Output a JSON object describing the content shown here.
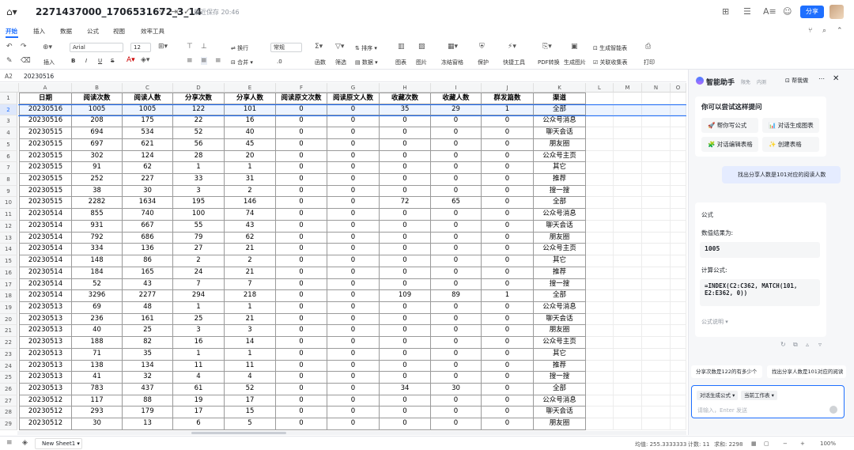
{
  "header": {
    "doc_title": "2271437000_1706531672_3_14",
    "save_status": "最近保存 20:46",
    "share_label": "分享"
  },
  "tabs": [
    "开始",
    "插入",
    "数据",
    "公式",
    "视图",
    "效率工具"
  ],
  "toolbar": {
    "insert": "插入",
    "font": "Arial",
    "font_size": "12",
    "wrap": "换行",
    "merge": "合并",
    "format": "常规",
    "decimal": ".0",
    "function": "函数",
    "filter": "筛选",
    "sort": "排序",
    "data": "数据",
    "chart": "图表",
    "image": "图片",
    "freeze": "冻结窗格",
    "protect": "保护",
    "quick_tools": "快捷工具",
    "pdf": "PDF转换",
    "gen_image": "生成图片",
    "gen_smart_table": "生成智能表",
    "link_collect": "关联收集表",
    "print": "打印"
  },
  "formula_bar": {
    "cell_ref": "A2",
    "value": "20230516"
  },
  "columns": [
    "A",
    "B",
    "C",
    "D",
    "E",
    "F",
    "G",
    "H",
    "I",
    "J",
    "K",
    "L",
    "M",
    "N",
    "O"
  ],
  "sheet": {
    "headers": [
      "日期",
      "阅读次数",
      "阅读人数",
      "分享次数",
      "分享人数",
      "阅读原文次数",
      "阅读原文人数",
      "收藏次数",
      "收藏人数",
      "群发篇数",
      "渠道"
    ],
    "rows": [
      [
        "20230516",
        "1005",
        "1005",
        "122",
        "101",
        "0",
        "0",
        "35",
        "29",
        "1",
        "全部"
      ],
      [
        "20230516",
        "208",
        "175",
        "22",
        "16",
        "0",
        "0",
        "0",
        "0",
        "0",
        "公众号消息"
      ],
      [
        "20230515",
        "694",
        "534",
        "52",
        "40",
        "0",
        "0",
        "0",
        "0",
        "0",
        "聊天会话"
      ],
      [
        "20230515",
        "697",
        "621",
        "56",
        "45",
        "0",
        "0",
        "0",
        "0",
        "0",
        "朋友圈"
      ],
      [
        "20230515",
        "302",
        "124",
        "28",
        "20",
        "0",
        "0",
        "0",
        "0",
        "0",
        "公众号主页"
      ],
      [
        "20230515",
        "91",
        "62",
        "1",
        "1",
        "0",
        "0",
        "0",
        "0",
        "0",
        "其它"
      ],
      [
        "20230515",
        "252",
        "227",
        "33",
        "31",
        "0",
        "0",
        "0",
        "0",
        "0",
        "推荐"
      ],
      [
        "20230515",
        "38",
        "30",
        "3",
        "2",
        "0",
        "0",
        "0",
        "0",
        "0",
        "搜一搜"
      ],
      [
        "20230515",
        "2282",
        "1634",
        "195",
        "146",
        "0",
        "0",
        "72",
        "65",
        "0",
        "全部"
      ],
      [
        "20230514",
        "855",
        "740",
        "100",
        "74",
        "0",
        "0",
        "0",
        "0",
        "0",
        "公众号消息"
      ],
      [
        "20230514",
        "931",
        "667",
        "55",
        "43",
        "0",
        "0",
        "0",
        "0",
        "0",
        "聊天会话"
      ],
      [
        "20230514",
        "792",
        "686",
        "79",
        "62",
        "0",
        "0",
        "0",
        "0",
        "0",
        "朋友圈"
      ],
      [
        "20230514",
        "334",
        "136",
        "27",
        "21",
        "0",
        "0",
        "0",
        "0",
        "0",
        "公众号主页"
      ],
      [
        "20230514",
        "148",
        "86",
        "2",
        "2",
        "0",
        "0",
        "0",
        "0",
        "0",
        "其它"
      ],
      [
        "20230514",
        "184",
        "165",
        "24",
        "21",
        "0",
        "0",
        "0",
        "0",
        "0",
        "推荐"
      ],
      [
        "20230514",
        "52",
        "43",
        "7",
        "7",
        "0",
        "0",
        "0",
        "0",
        "0",
        "搜一搜"
      ],
      [
        "20230514",
        "3296",
        "2277",
        "294",
        "218",
        "0",
        "0",
        "109",
        "89",
        "1",
        "全部"
      ],
      [
        "20230513",
        "69",
        "48",
        "1",
        "1",
        "0",
        "0",
        "0",
        "0",
        "0",
        "公众号消息"
      ],
      [
        "20230513",
        "236",
        "161",
        "25",
        "21",
        "0",
        "0",
        "0",
        "0",
        "0",
        "聊天会话"
      ],
      [
        "20230513",
        "40",
        "25",
        "3",
        "3",
        "0",
        "0",
        "0",
        "0",
        "0",
        "朋友圈"
      ],
      [
        "20230513",
        "188",
        "82",
        "16",
        "14",
        "0",
        "0",
        "0",
        "0",
        "0",
        "公众号主页"
      ],
      [
        "20230513",
        "71",
        "35",
        "1",
        "1",
        "0",
        "0",
        "0",
        "0",
        "0",
        "其它"
      ],
      [
        "20230513",
        "138",
        "134",
        "11",
        "11",
        "0",
        "0",
        "0",
        "0",
        "0",
        "推荐"
      ],
      [
        "20230513",
        "41",
        "32",
        "4",
        "4",
        "0",
        "0",
        "0",
        "0",
        "0",
        "搜一搜"
      ],
      [
        "20230513",
        "783",
        "437",
        "61",
        "52",
        "0",
        "0",
        "34",
        "30",
        "0",
        "全部"
      ],
      [
        "20230512",
        "117",
        "88",
        "19",
        "17",
        "0",
        "0",
        "0",
        "0",
        "0",
        "公众号消息"
      ],
      [
        "20230512",
        "293",
        "179",
        "17",
        "15",
        "0",
        "0",
        "0",
        "0",
        "0",
        "聊天会话"
      ],
      [
        "20230512",
        "30",
        "13",
        "6",
        "5",
        "0",
        "0",
        "0",
        "0",
        "0",
        "朋友圈"
      ]
    ]
  },
  "row_numbers": [
    "1",
    "2",
    "3",
    "4",
    "5",
    "6",
    "7",
    "8",
    "9",
    "10",
    "11",
    "12",
    "13",
    "14",
    "15",
    "16",
    "17",
    "18",
    "19",
    "20",
    "21",
    "22",
    "23",
    "24",
    "25",
    "26",
    "27",
    "28",
    "29"
  ],
  "ai": {
    "title": "智能助手",
    "badge1": "限免",
    "badge2": "内测",
    "help": "帮我做",
    "prompt_title": "你可以尝试这样提问",
    "chips": [
      "帮你写公式",
      "对话生成图表",
      "对话编辑表格",
      "创建表格"
    ],
    "user_msg": "找出分享人数是101对应的阅读人数",
    "answer_label": "公式",
    "result_label": "数值结果为:",
    "result_value": "1005",
    "formula_label": "计算公式:",
    "formula": "=INDEX(C2:C362, MATCH(101,\nE2:E362, 0))",
    "explain": "公式说明",
    "suggest1": "分享次数是122的有多少个",
    "suggest2": "找出分享人数是101对应的阅读",
    "tag1": "对话生成公式",
    "tag2": "当前工作表",
    "placeholder": "请输入，Enter 发送"
  },
  "bottom": {
    "sheet_name": "New Sheet1",
    "avg": "均值: 255.3333333",
    "count": "计数: 11",
    "sum": "求和: 2298",
    "zoom": "100%"
  }
}
